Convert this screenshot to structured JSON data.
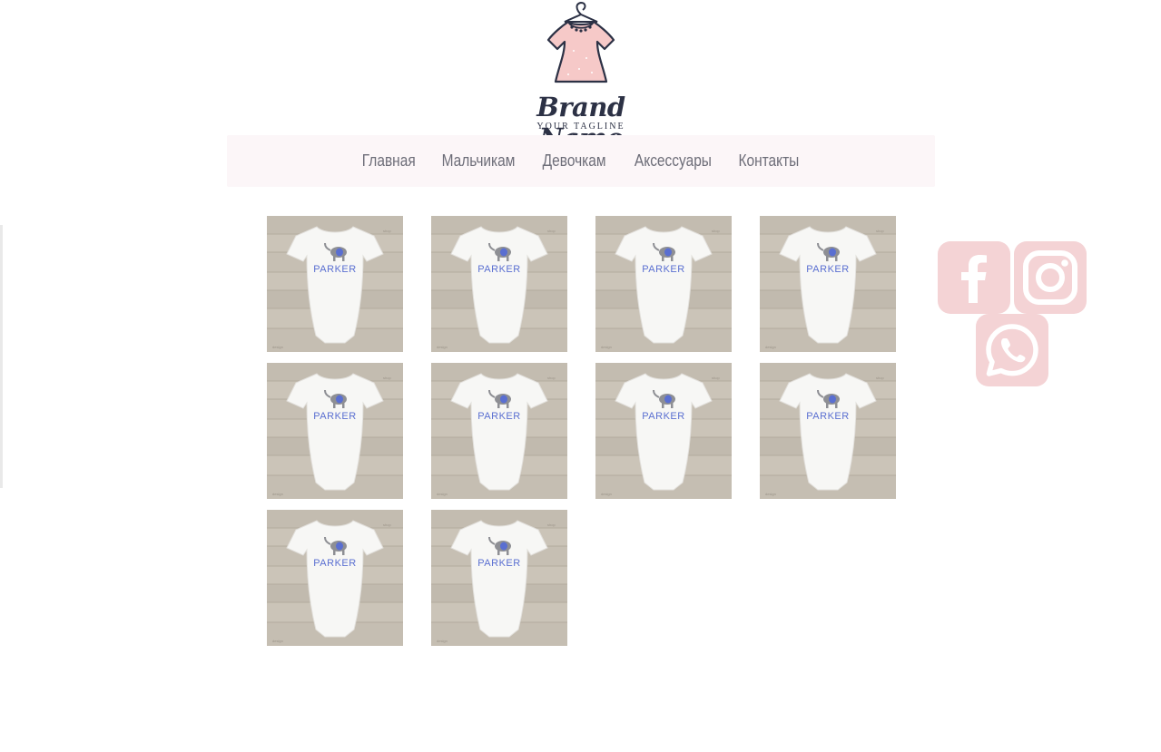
{
  "logo": {
    "brand_name": "Brand Name",
    "tagline": "YOUR TAGLINE",
    "icon": "dress-on-hanger-icon"
  },
  "nav": {
    "items": [
      {
        "label": "Главная"
      },
      {
        "label": "Мальчикам"
      },
      {
        "label": "Девочкам"
      },
      {
        "label": "Аксессуары"
      },
      {
        "label": "Контакты"
      }
    ]
  },
  "products": [
    {
      "label": "PARKER"
    },
    {
      "label": "PARKER"
    },
    {
      "label": "PARKER"
    },
    {
      "label": "PARKER"
    },
    {
      "label": "PARKER"
    },
    {
      "label": "PARKER"
    },
    {
      "label": "PARKER"
    },
    {
      "label": "PARKER"
    },
    {
      "label": "PARKER"
    },
    {
      "label": "PARKER"
    }
  ],
  "social": [
    {
      "icon": "facebook-icon"
    },
    {
      "icon": "instagram-icon"
    },
    {
      "icon": "whatsapp-icon"
    }
  ],
  "colors": {
    "nav_background": "#fcf6f8",
    "nav_text": "#6d6d78",
    "social_background": "#f4d3d5",
    "dress_pink": "#f6c9c8",
    "brand_navy": "#2c3145",
    "print_blue": "#5a6fd1"
  }
}
